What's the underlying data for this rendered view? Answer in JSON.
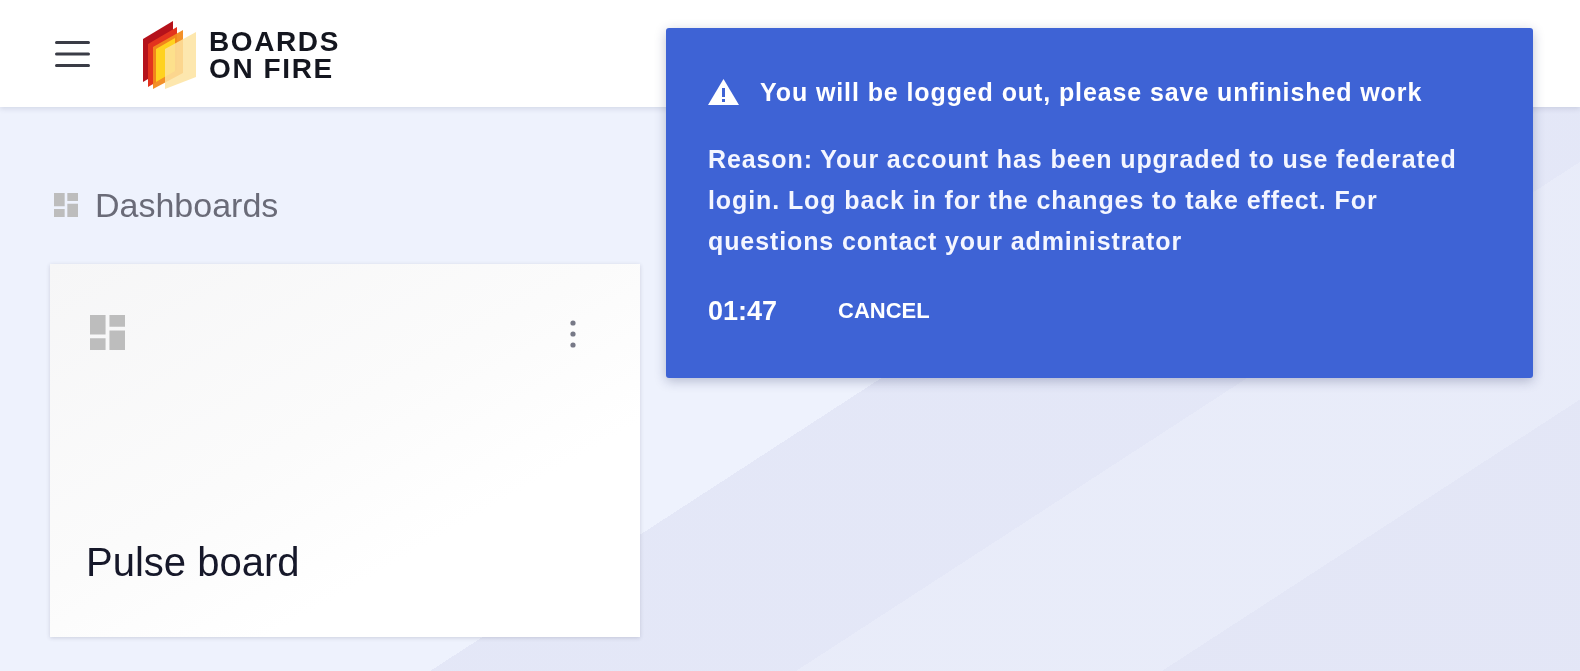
{
  "brand": {
    "lines": [
      "BOARDS",
      "ON FIRE"
    ]
  },
  "section": {
    "title": "Dashboards"
  },
  "dashboards": [
    {
      "title": "Pulse board"
    }
  ],
  "notification": {
    "title": "You will be logged out, please save unfinished work",
    "message": "Reason: Your account has been upgraded to use federated\nlogin. Log back in for the changes to take effect. For\nquestions contact your administrator",
    "countdown": "01:47",
    "action": "CANCEL"
  }
}
